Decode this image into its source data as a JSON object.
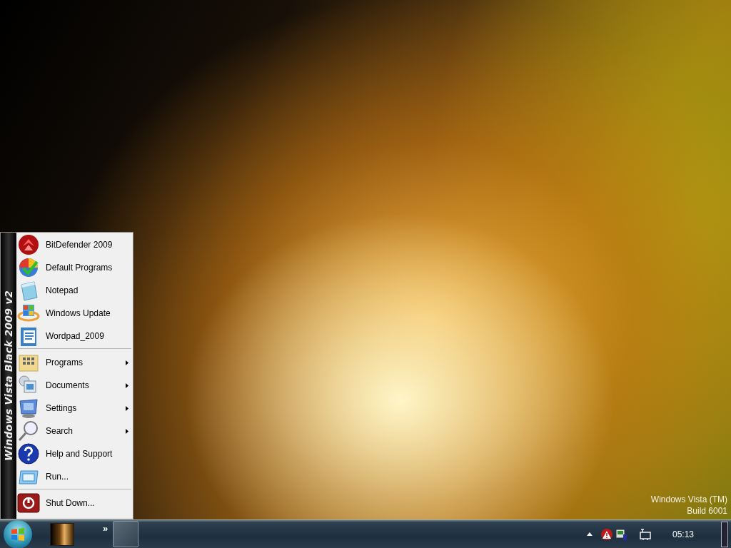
{
  "start_menu": {
    "banner": "Windows Vista Black 2009 v2",
    "sections": [
      [
        {
          "label": "BitDefender 2009",
          "has_submenu": false
        },
        {
          "label": "Default Programs",
          "has_submenu": false
        },
        {
          "label": "Notepad",
          "has_submenu": false
        },
        {
          "label": "Windows Update",
          "has_submenu": false
        },
        {
          "label": "Wordpad_2009",
          "has_submenu": false
        }
      ],
      [
        {
          "label": "Programs",
          "has_submenu": true
        },
        {
          "label": "Documents",
          "has_submenu": true
        },
        {
          "label": "Settings",
          "has_submenu": true
        },
        {
          "label": "Search",
          "has_submenu": true
        },
        {
          "label": "Help and Support",
          "has_submenu": false
        },
        {
          "label": "Run...",
          "has_submenu": false
        }
      ],
      [
        {
          "label": "Shut Down...",
          "has_submenu": false
        }
      ]
    ]
  },
  "desktop_watermark": [
    "Windows Vista (TM)",
    "Build 6001"
  ],
  "taskbar": {
    "quick_launch_more": "»",
    "clock": "05:13"
  }
}
